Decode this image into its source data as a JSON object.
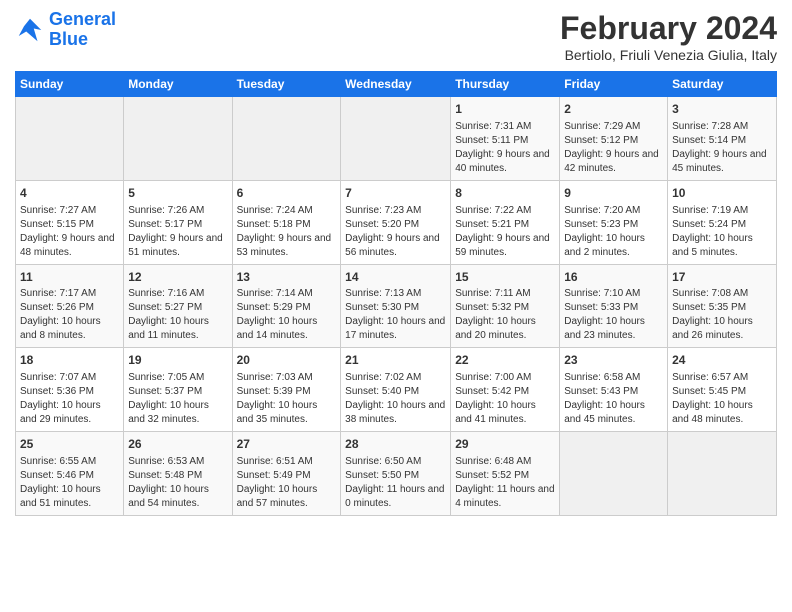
{
  "logo": {
    "line1": "General",
    "line2": "Blue"
  },
  "title": "February 2024",
  "subtitle": "Bertiolo, Friuli Venezia Giulia, Italy",
  "days_of_week": [
    "Sunday",
    "Monday",
    "Tuesday",
    "Wednesday",
    "Thursday",
    "Friday",
    "Saturday"
  ],
  "weeks": [
    [
      {
        "day": "",
        "info": ""
      },
      {
        "day": "",
        "info": ""
      },
      {
        "day": "",
        "info": ""
      },
      {
        "day": "",
        "info": ""
      },
      {
        "day": "1",
        "info": "Sunrise: 7:31 AM\nSunset: 5:11 PM\nDaylight: 9 hours and 40 minutes."
      },
      {
        "day": "2",
        "info": "Sunrise: 7:29 AM\nSunset: 5:12 PM\nDaylight: 9 hours and 42 minutes."
      },
      {
        "day": "3",
        "info": "Sunrise: 7:28 AM\nSunset: 5:14 PM\nDaylight: 9 hours and 45 minutes."
      }
    ],
    [
      {
        "day": "4",
        "info": "Sunrise: 7:27 AM\nSunset: 5:15 PM\nDaylight: 9 hours and 48 minutes."
      },
      {
        "day": "5",
        "info": "Sunrise: 7:26 AM\nSunset: 5:17 PM\nDaylight: 9 hours and 51 minutes."
      },
      {
        "day": "6",
        "info": "Sunrise: 7:24 AM\nSunset: 5:18 PM\nDaylight: 9 hours and 53 minutes."
      },
      {
        "day": "7",
        "info": "Sunrise: 7:23 AM\nSunset: 5:20 PM\nDaylight: 9 hours and 56 minutes."
      },
      {
        "day": "8",
        "info": "Sunrise: 7:22 AM\nSunset: 5:21 PM\nDaylight: 9 hours and 59 minutes."
      },
      {
        "day": "9",
        "info": "Sunrise: 7:20 AM\nSunset: 5:23 PM\nDaylight: 10 hours and 2 minutes."
      },
      {
        "day": "10",
        "info": "Sunrise: 7:19 AM\nSunset: 5:24 PM\nDaylight: 10 hours and 5 minutes."
      }
    ],
    [
      {
        "day": "11",
        "info": "Sunrise: 7:17 AM\nSunset: 5:26 PM\nDaylight: 10 hours and 8 minutes."
      },
      {
        "day": "12",
        "info": "Sunrise: 7:16 AM\nSunset: 5:27 PM\nDaylight: 10 hours and 11 minutes."
      },
      {
        "day": "13",
        "info": "Sunrise: 7:14 AM\nSunset: 5:29 PM\nDaylight: 10 hours and 14 minutes."
      },
      {
        "day": "14",
        "info": "Sunrise: 7:13 AM\nSunset: 5:30 PM\nDaylight: 10 hours and 17 minutes."
      },
      {
        "day": "15",
        "info": "Sunrise: 7:11 AM\nSunset: 5:32 PM\nDaylight: 10 hours and 20 minutes."
      },
      {
        "day": "16",
        "info": "Sunrise: 7:10 AM\nSunset: 5:33 PM\nDaylight: 10 hours and 23 minutes."
      },
      {
        "day": "17",
        "info": "Sunrise: 7:08 AM\nSunset: 5:35 PM\nDaylight: 10 hours and 26 minutes."
      }
    ],
    [
      {
        "day": "18",
        "info": "Sunrise: 7:07 AM\nSunset: 5:36 PM\nDaylight: 10 hours and 29 minutes."
      },
      {
        "day": "19",
        "info": "Sunrise: 7:05 AM\nSunset: 5:37 PM\nDaylight: 10 hours and 32 minutes."
      },
      {
        "day": "20",
        "info": "Sunrise: 7:03 AM\nSunset: 5:39 PM\nDaylight: 10 hours and 35 minutes."
      },
      {
        "day": "21",
        "info": "Sunrise: 7:02 AM\nSunset: 5:40 PM\nDaylight: 10 hours and 38 minutes."
      },
      {
        "day": "22",
        "info": "Sunrise: 7:00 AM\nSunset: 5:42 PM\nDaylight: 10 hours and 41 minutes."
      },
      {
        "day": "23",
        "info": "Sunrise: 6:58 AM\nSunset: 5:43 PM\nDaylight: 10 hours and 45 minutes."
      },
      {
        "day": "24",
        "info": "Sunrise: 6:57 AM\nSunset: 5:45 PM\nDaylight: 10 hours and 48 minutes."
      }
    ],
    [
      {
        "day": "25",
        "info": "Sunrise: 6:55 AM\nSunset: 5:46 PM\nDaylight: 10 hours and 51 minutes."
      },
      {
        "day": "26",
        "info": "Sunrise: 6:53 AM\nSunset: 5:48 PM\nDaylight: 10 hours and 54 minutes."
      },
      {
        "day": "27",
        "info": "Sunrise: 6:51 AM\nSunset: 5:49 PM\nDaylight: 10 hours and 57 minutes."
      },
      {
        "day": "28",
        "info": "Sunrise: 6:50 AM\nSunset: 5:50 PM\nDaylight: 11 hours and 0 minutes."
      },
      {
        "day": "29",
        "info": "Sunrise: 6:48 AM\nSunset: 5:52 PM\nDaylight: 11 hours and 4 minutes."
      },
      {
        "day": "",
        "info": ""
      },
      {
        "day": "",
        "info": ""
      }
    ]
  ]
}
